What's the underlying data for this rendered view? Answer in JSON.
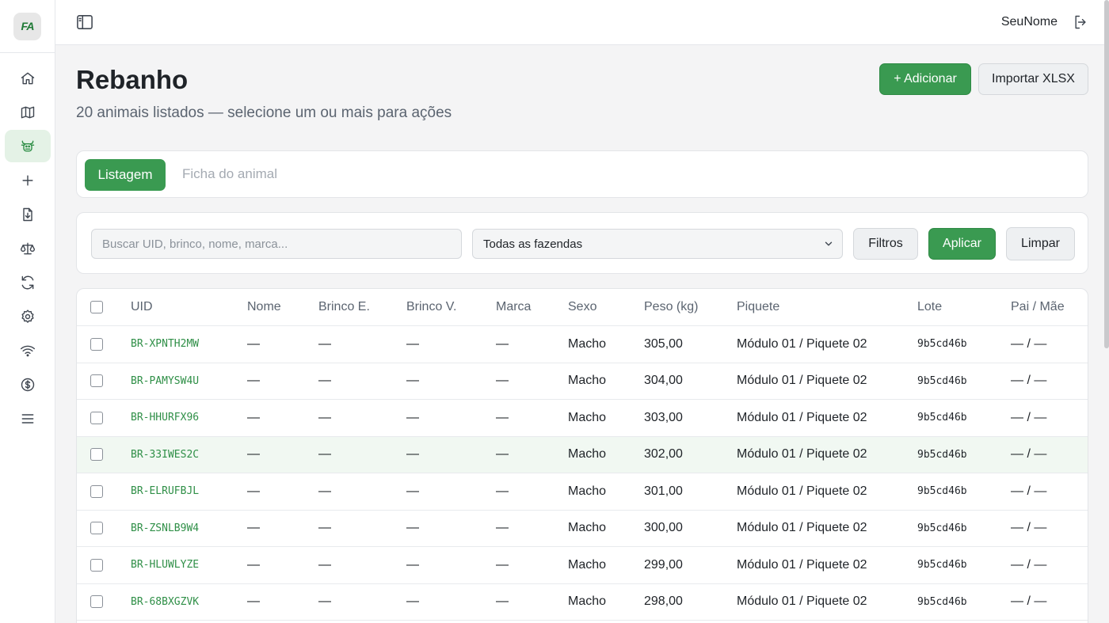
{
  "app": {
    "logo_text": "FA",
    "username": "SeuNome"
  },
  "sidebar": {
    "items": [
      {
        "icon": "home-icon",
        "active": false
      },
      {
        "icon": "map-icon",
        "active": false
      },
      {
        "icon": "cattle-icon",
        "active": true
      },
      {
        "icon": "plus-icon",
        "active": false
      },
      {
        "icon": "file-import-icon",
        "active": false
      },
      {
        "icon": "scale-icon",
        "active": false
      },
      {
        "icon": "refresh-icon",
        "active": false
      },
      {
        "icon": "gear-icon",
        "active": false
      },
      {
        "icon": "wifi-icon",
        "active": false
      },
      {
        "icon": "dollar-icon",
        "active": false
      },
      {
        "icon": "menu-icon",
        "active": false
      }
    ]
  },
  "header": {
    "title": "Rebanho",
    "subtitle": "20 animais listados — selecione um ou mais para ações",
    "add_label": "+ Adicionar",
    "import_label": "Importar XLSX"
  },
  "tabs": {
    "active": "Listagem",
    "inactive": "Ficha do animal"
  },
  "filters": {
    "search_placeholder": "Buscar UID, brinco, nome, marca...",
    "search_value": "",
    "farm_selected": "Todas as fazendas",
    "filtros_label": "Filtros",
    "aplicar_label": "Aplicar",
    "limpar_label": "Limpar"
  },
  "table": {
    "columns": [
      "UID",
      "Nome",
      "Brinco E.",
      "Brinco V.",
      "Marca",
      "Sexo",
      "Peso (kg)",
      "Piquete",
      "Lote",
      "Pai / Mãe"
    ],
    "rows": [
      {
        "uid": "BR-XPNTH2MW",
        "nome": "—",
        "brinco_e": "—",
        "brinco_v": "—",
        "marca": "—",
        "sexo": "Macho",
        "peso": "305,00",
        "piquete": "Módulo 01 / Piquete 02",
        "lote": "9b5cd46b",
        "pais": "— / —"
      },
      {
        "uid": "BR-PAMYSW4U",
        "nome": "—",
        "brinco_e": "—",
        "brinco_v": "—",
        "marca": "—",
        "sexo": "Macho",
        "peso": "304,00",
        "piquete": "Módulo 01 / Piquete 02",
        "lote": "9b5cd46b",
        "pais": "— / —"
      },
      {
        "uid": "BR-HHURFX96",
        "nome": "—",
        "brinco_e": "—",
        "brinco_v": "—",
        "marca": "—",
        "sexo": "Macho",
        "peso": "303,00",
        "piquete": "Módulo 01 / Piquete 02",
        "lote": "9b5cd46b",
        "pais": "— / —"
      },
      {
        "uid": "BR-33IWES2C",
        "nome": "—",
        "brinco_e": "—",
        "brinco_v": "—",
        "marca": "—",
        "sexo": "Macho",
        "peso": "302,00",
        "piquete": "Módulo 01 / Piquete 02",
        "lote": "9b5cd46b",
        "pais": "— / —"
      },
      {
        "uid": "BR-ELRUFBJL",
        "nome": "—",
        "brinco_e": "—",
        "brinco_v": "—",
        "marca": "—",
        "sexo": "Macho",
        "peso": "301,00",
        "piquete": "Módulo 01 / Piquete 02",
        "lote": "9b5cd46b",
        "pais": "— / —"
      },
      {
        "uid": "BR-ZSNLB9W4",
        "nome": "—",
        "brinco_e": "—",
        "brinco_v": "—",
        "marca": "—",
        "sexo": "Macho",
        "peso": "300,00",
        "piquete": "Módulo 01 / Piquete 02",
        "lote": "9b5cd46b",
        "pais": "— / —"
      },
      {
        "uid": "BR-HLUWLYZE",
        "nome": "—",
        "brinco_e": "—",
        "brinco_v": "—",
        "marca": "—",
        "sexo": "Macho",
        "peso": "299,00",
        "piquete": "Módulo 01 / Piquete 02",
        "lote": "9b5cd46b",
        "pais": "— / —"
      },
      {
        "uid": "BR-68BXGZVK",
        "nome": "—",
        "brinco_e": "—",
        "brinco_v": "—",
        "marca": "—",
        "sexo": "Macho",
        "peso": "298,00",
        "piquete": "Módulo 01 / Piquete 02",
        "lote": "9b5cd46b",
        "pais": "— / —"
      }
    ]
  },
  "colors": {
    "accent": "#3a9a51",
    "accent_text": "#2f8f47",
    "accent_soft": "#e4f2e6",
    "row_highlight": "#f1f8f2"
  }
}
